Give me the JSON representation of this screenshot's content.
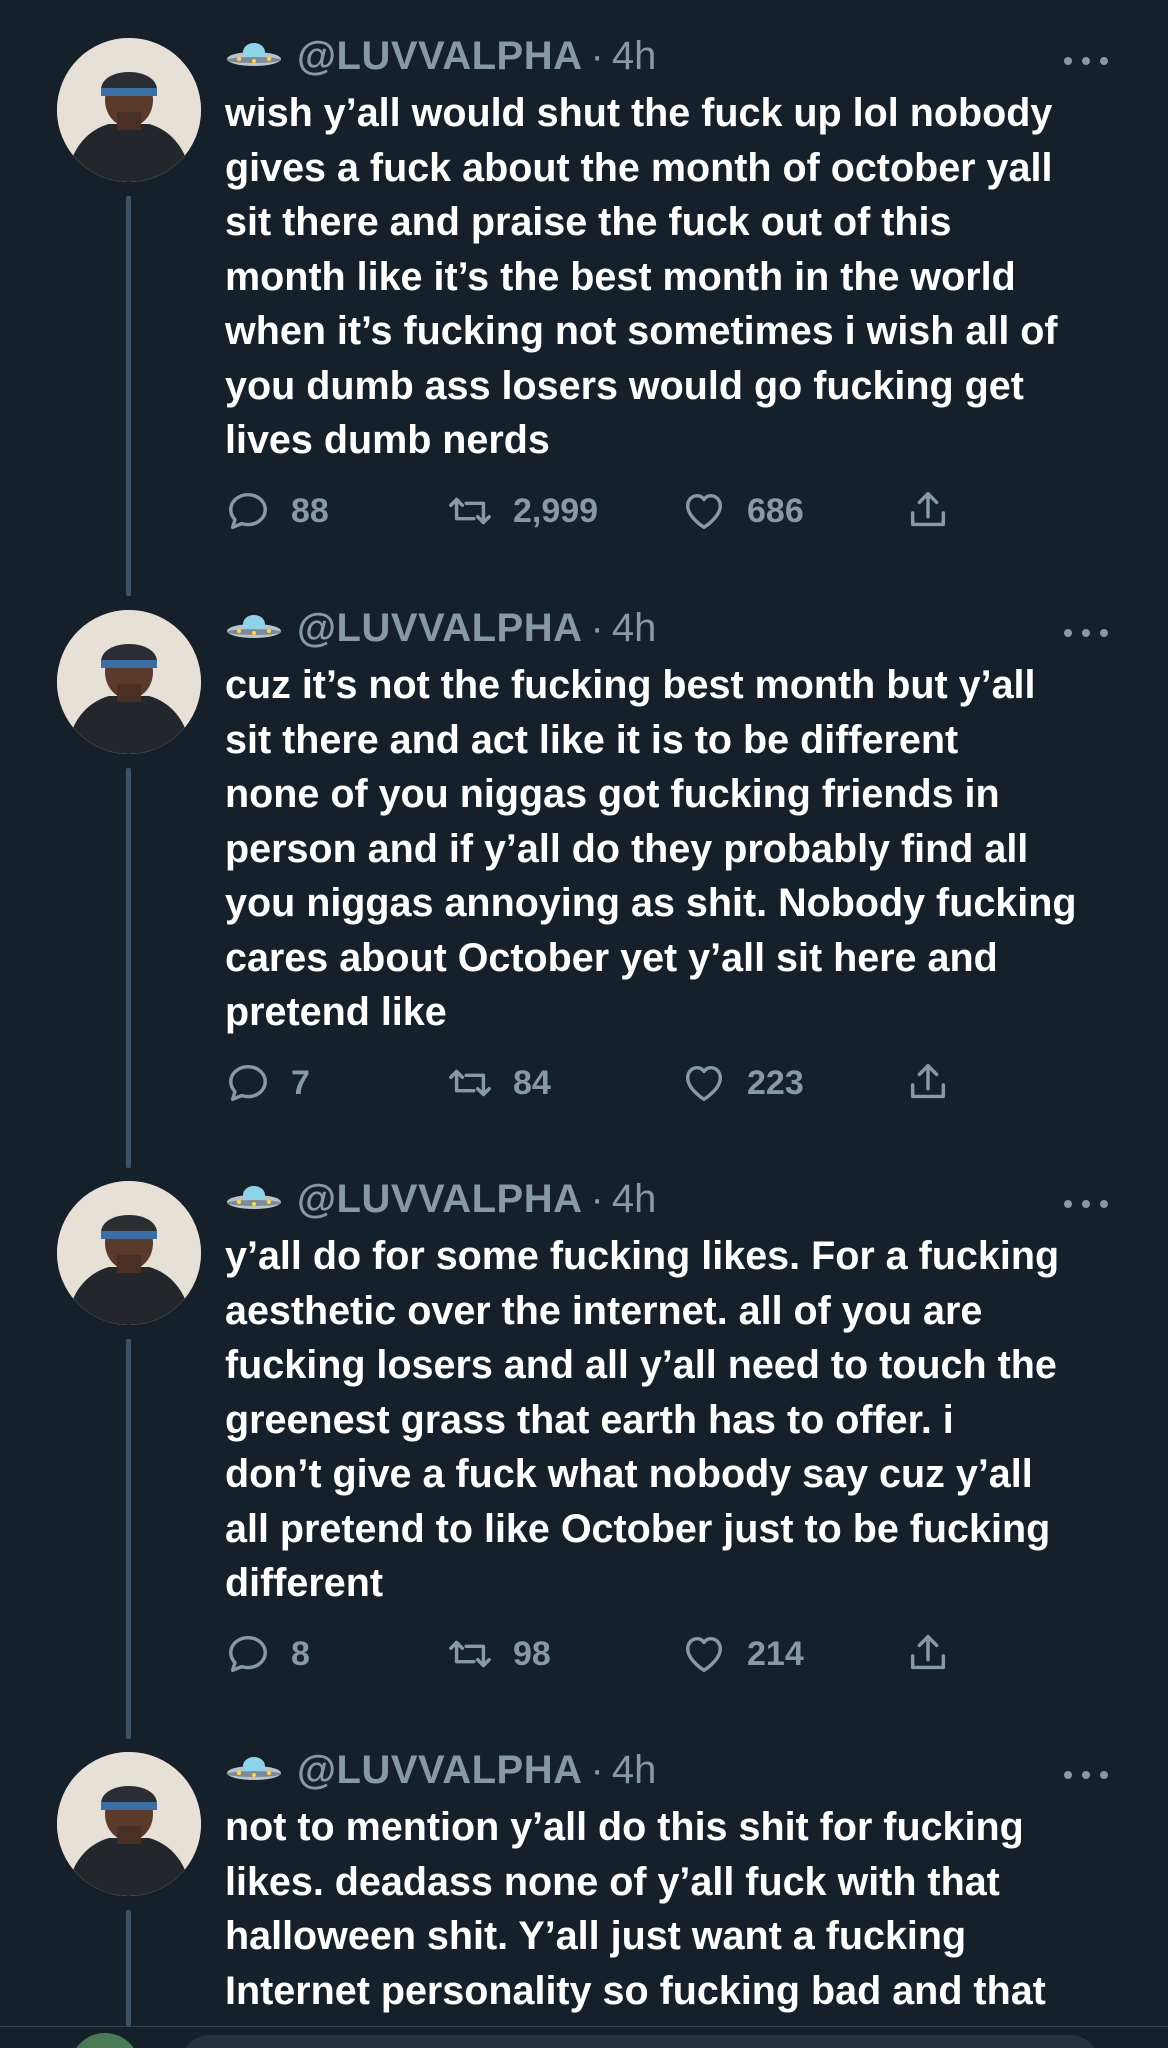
{
  "tweets": [
    {
      "emoji": "ufo",
      "handle": "@LUVVALPHA",
      "separator": "·",
      "time": "4h",
      "lines": [
        "wish y’all would shut the fuck up lol nobody",
        "gives a fuck about the month of october yall",
        "sit there and praise the fuck out of this",
        "month like it’s the best month in the world",
        "when it’s fucking not sometimes i wish all of",
        "you dumb ass losers would go fucking get",
        "lives dumb nerds"
      ],
      "replies": "88",
      "retweets": "2,999",
      "likes": "686"
    },
    {
      "emoji": "ufo",
      "handle": "@LUVVALPHA",
      "separator": "·",
      "time": "4h",
      "lines": [
        "cuz it’s not the fucking best month but y’all",
        "sit there and act like it is to be different",
        "none of you niggas got fucking friends in",
        "person and if y’all do they probably find all",
        "you niggas annoying as shit. Nobody fucking",
        "cares about October yet y’all sit here and",
        "pretend like"
      ],
      "replies": "7",
      "retweets": "84",
      "likes": "223"
    },
    {
      "emoji": "ufo",
      "handle": "@LUVVALPHA",
      "separator": "·",
      "time": "4h",
      "lines": [
        "y’all do for some fucking likes. For a fucking",
        "aesthetic over the internet. all of you are",
        "fucking losers and all y’all need to touch the",
        "greenest grass that earth has to offer. i",
        "don’t give a fuck what nobody say cuz y’all",
        "all pretend to like October just to be fucking",
        "different"
      ],
      "replies": "8",
      "retweets": "98",
      "likes": "214"
    },
    {
      "emoji": "ufo",
      "handle": "@LUVVALPHA",
      "separator": "·",
      "time": "4h",
      "lines": [
        "not to mention y’all do this shit for fucking",
        "likes. deadass none of y’all fuck with that",
        "halloween shit. Y’all just want a fucking",
        "Internet personality so fucking bad and that"
      ]
    }
  ],
  "icons": {
    "reply": "reply-icon",
    "retweet": "retweet-icon",
    "like": "heart-icon",
    "share": "share-icon",
    "more": "more-icon"
  },
  "colors": {
    "background": "#15202b",
    "text": "#ffffff",
    "secondary": "#8899a6",
    "thread_line": "#3d5466"
  }
}
